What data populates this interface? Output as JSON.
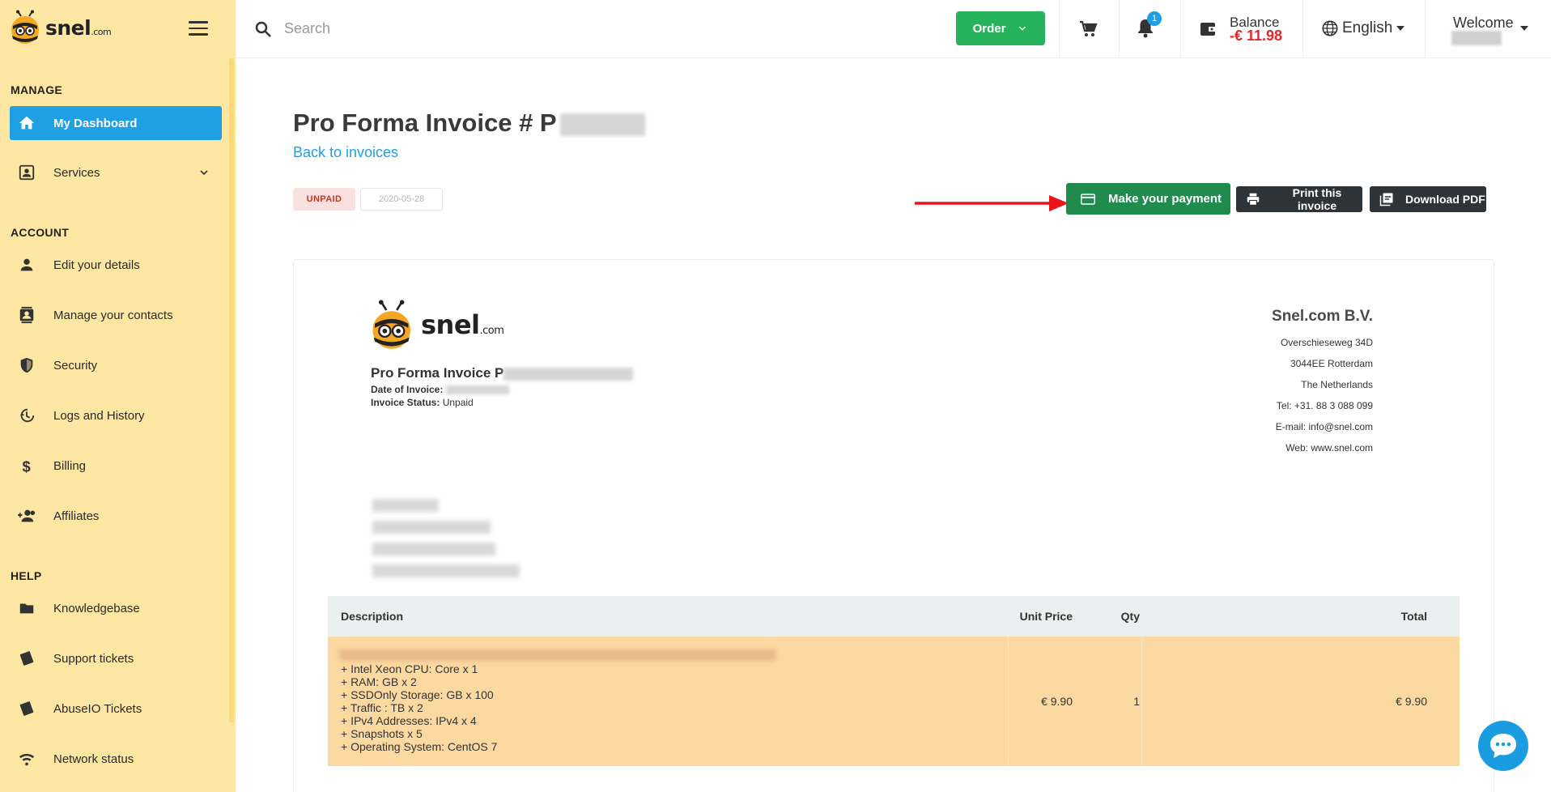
{
  "sidebar": {
    "logo": {
      "brand": "snel",
      "suffix": ".com"
    },
    "sections": {
      "manage": "MANAGE",
      "account": "ACCOUNT",
      "help": "HELP"
    },
    "items": {
      "dashboard": "My Dashboard",
      "services": "Services",
      "edit_details": "Edit your details",
      "contacts": "Manage your contacts",
      "security": "Security",
      "logs": "Logs and History",
      "billing": "Billing",
      "affiliates": "Affiliates",
      "knowledgebase": "Knowledgebase",
      "support": "Support tickets",
      "abuseio": "AbuseIO Tickets",
      "network": "Network status"
    }
  },
  "topbar": {
    "search_placeholder": "Search",
    "order_label": "Order",
    "notification_count": "1",
    "balance_label": "Balance",
    "balance_value": "-€ 11.98",
    "language": "English",
    "welcome": "Welcome"
  },
  "invoice": {
    "title_prefix": "Pro Forma Invoice # P",
    "back_link": "Back to invoices",
    "status_badge": "UNPAID",
    "date_badge": "2020-05-28",
    "buttons": {
      "pay": "Make your payment",
      "print": "Print this invoice",
      "pdf": "Download PDF"
    },
    "doc": {
      "logo_brand": "snel",
      "logo_suffix": ".com",
      "title_prefix": "Pro Forma Invoice P",
      "date_label": "Date of Invoice:",
      "status_label": "Invoice Status:",
      "status_value": "Unpaid"
    },
    "company": {
      "name": "Snel.com B.V.",
      "lines": [
        "Overschieseweg 34D",
        "3044EE Rotterdam",
        "The Netherlands",
        "Tel: +31. 88 3 088 099",
        "E-mail: info@snel.com",
        "Web: www.snel.com"
      ]
    },
    "table": {
      "headers": [
        "Description",
        "Unit Price",
        "Qty",
        "Total"
      ],
      "row": {
        "lines": [
          "+ Intel Xeon CPU: Core x 1",
          "+ RAM: GB x 2",
          "+ SSDOnly Storage: GB x 100",
          "+ Traffic : TB x 2",
          "+ IPv4 Addresses: IPv4 x 4",
          "+ Snapshots x 5",
          "+ Operating System: CentOS 7"
        ],
        "unit_price": "€ 9.90",
        "qty": "1",
        "total": "€ 9.90"
      }
    }
  },
  "colors": {
    "sidebar_bg": "#fde7a2",
    "active_nav": "#1fa0e5",
    "order_green": "#27b35b",
    "pay_green": "#1f8b4d",
    "balance_red": "#e5262b",
    "row_orange": "#fcd9a0"
  }
}
